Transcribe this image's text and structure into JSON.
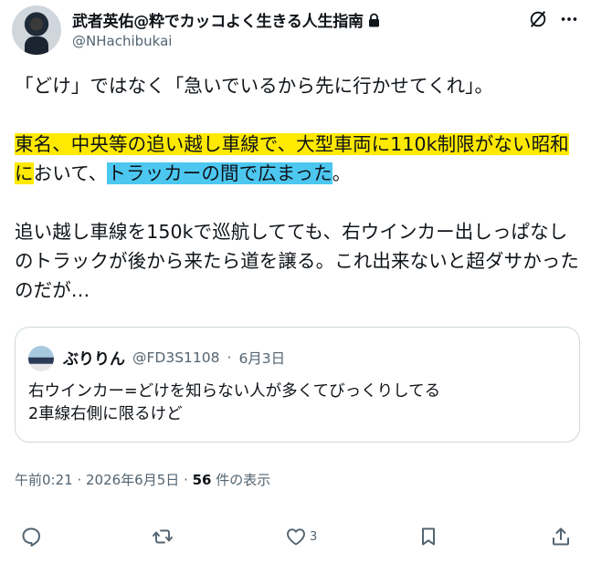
{
  "author": {
    "display_name": "武者英佑@粋でカッコよく生きる人生指南",
    "handle": "@NHachibukai",
    "lock_icon": "lock-icon"
  },
  "tweet": {
    "line1": "「どけ」ではなく「急いでいるから先に行かせてくれ」。",
    "p2_hl_yellow": "東名、中央等の追い越し車線で、大型車両に110k制限がない昭和に",
    "p2_mid": "おいて、",
    "p2_hl_blue": "トラッカーの間で広まった",
    "p2_end": "。",
    "p3": "追い越し車線を150kで巡航してても、右ウインカー出しっぱなしのトラックが後から来たら道を譲る。これ出来ないと超ダサかったのだが…"
  },
  "quote": {
    "name": "ぶりりん",
    "handle": "@FD3S1108",
    "separator": "·",
    "date": "6月3日",
    "line1": "右ウインカー=どけを知らない人が多くてびっくりしてる",
    "line2": "2車線右側に限るけど"
  },
  "meta": {
    "time": "午前0:21 · 2026年6月5日 · ",
    "views": "56",
    "views_label": " 件の表示"
  },
  "actions": {
    "like_count": "3",
    "icons": [
      "reply-icon",
      "retweet-icon",
      "like-icon",
      "bookmark-icon",
      "share-icon"
    ]
  },
  "colors": {
    "highlight_yellow": "#ffe900",
    "highlight_blue": "#4cc7f0",
    "secondary_text": "#536471"
  }
}
